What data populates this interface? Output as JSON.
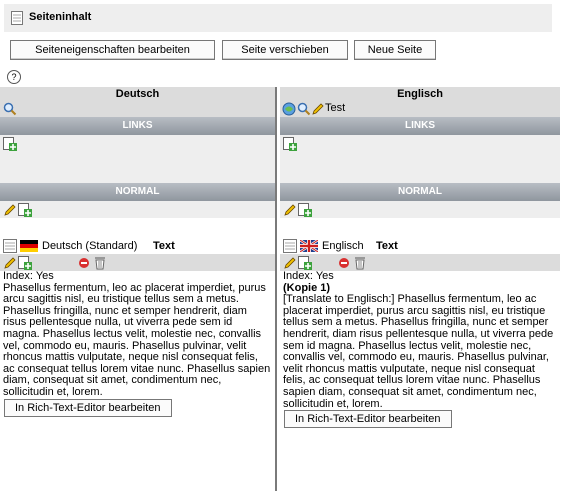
{
  "page": {
    "title": "Seiteninhalt"
  },
  "toolbar": {
    "edit_properties": "Seiteneigenschaften bearbeiten",
    "move_page": "Seite verschieben",
    "new_page": "Neue Seite",
    "help": "?"
  },
  "columns": {
    "left": {
      "language": "Deutsch",
      "sections": {
        "left_label": "LINKS",
        "normal_label": "NORMAL"
      },
      "element": {
        "language_label": "Deutsch (Standard)",
        "type_label": "Text",
        "index": "Index: Yes",
        "body": "Phasellus fermentum, leo ac placerat imperdiet, purus arcu sagittis nisl, eu tristique tellus sem a metus. Phasellus fringilla, nunc et semper hendrerit, diam risus pellentesque nulla, ut viverra pede sem id magna. Phasellus lectus velit, molestie nec, convallis vel, commodo eu, mauris. Phasellus pulvinar, velit rhoncus mattis vulputate, neque nisl consequat felis, ac consequat tellus lorem vitae nunc. Phasellus sapien diam, consequat sit amet, condimentum nec, sollicitudin et, lorem.",
        "rte_button": "In Rich-Text-Editor bearbeiten"
      }
    },
    "right": {
      "language": "Englisch",
      "test_label": "Test",
      "sections": {
        "left_label": "LINKS",
        "normal_label": "NORMAL"
      },
      "element": {
        "language_label": "Englisch",
        "type_label": "Text",
        "index": "Index: Yes",
        "copy_label": "(Kopie 1)",
        "body": "[Translate to Englisch:] Phasellus fermentum, leo ac placerat imperdiet, purus arcu sagittis nisl, eu tristique tellus sem a metus. Phasellus fringilla, nunc et semper hendrerit, diam risus pellentesque nulla, ut viverra pede sem id magna. Phasellus lectus velit, molestie nec, convallis vel, commodo eu, mauris. Phasellus pulvinar, velit rhoncus mattis vulputate, neque nisl consequat felis, ac consequat tellus lorem vitae nunc. Phasellus sapien diam, consequat sit amet, condimentum nec, sollicitudin et, lorem.",
        "rte_button": "In Rich-Text-Editor bearbeiten"
      }
    }
  }
}
